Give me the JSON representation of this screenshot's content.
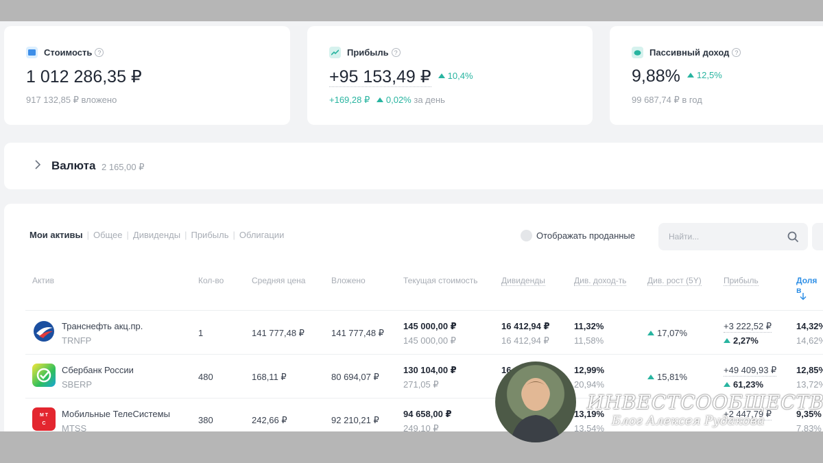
{
  "summary": {
    "value": {
      "label": "Стоимость",
      "amount": "1 012 286,35 ₽",
      "sub": "917 132,85 ₽ вложено"
    },
    "profit": {
      "label": "Прибыль",
      "amount": "+95 153,49 ₽",
      "change": "10,4%",
      "day_amount": "+169,28 ₽",
      "day_change": "0,02%",
      "day_label": "за день"
    },
    "passive": {
      "label": "Пассивный доход",
      "amount": "9,88%",
      "change": "12,5%",
      "sub": "99 687,74 ₽ в год"
    }
  },
  "currency": {
    "label": "Валюта",
    "amount": "2 165,00 ₽"
  },
  "tabs": [
    "Мои активы",
    "Общее",
    "Дивиденды",
    "Прибыль",
    "Облигации"
  ],
  "show_sold_label": "Отображать проданные",
  "search_placeholder": "Найти...",
  "columns": [
    "Актив",
    "Кол-во",
    "Средняя цена",
    "Вложено",
    "Текущая стоимость",
    "Дивиденды",
    "Див. доход-ть",
    "Див. рост (5Y)",
    "Прибыль",
    "Доля в"
  ],
  "rows": [
    {
      "name": "Транснефть акц.пр.",
      "ticker": "TRNFP",
      "qty": "1",
      "avg": "141 777,48 ₽",
      "invested": "141 777,48 ₽",
      "cur": "145 000,00 ₽",
      "cur2": "145 000,00 ₽",
      "div": "16 412,94 ₽",
      "div2": "16 412,94 ₽",
      "yield": "11,32%",
      "yield2": "11,58%",
      "growth": "17,07%",
      "profit": "+3 222,52 ₽",
      "profit_pct": "2,27%",
      "share": "14,32%",
      "share2": "14,62%"
    },
    {
      "name": "Сбербанк России",
      "ticker": "SBERP",
      "qty": "480",
      "avg": "168,11 ₽",
      "invested": "80 694,07 ₽",
      "cur": "130 104,00 ₽",
      "cur2": "271,05 ₽",
      "div": "16 1",
      "div2": "",
      "yield": "12,99%",
      "yield2": "20,94%",
      "growth": "15,81%",
      "profit": "+49 409,93 ₽",
      "profit_pct": "61,23%",
      "share": "12,85%",
      "share2": "13,72%"
    },
    {
      "name": "Мобильные ТелеСистемы",
      "ticker": "MTSS",
      "qty": "380",
      "avg": "242,66 ₽",
      "invested": "92 210,21 ₽",
      "cur": "94 658,00 ₽",
      "cur2": "249,10 ₽",
      "div": "",
      "div2": "",
      "yield": "13,19%",
      "yield2": "13,54%",
      "growth": "",
      "profit": "+2 447,79 ₽",
      "profit_pct": "",
      "share": "9,35%",
      "share2": "7,83%"
    }
  ],
  "watermark": {
    "title": "ИНВЕСТСООБЩЕСТВО",
    "subtitle": "Блог Алексея Рудакова"
  },
  "colors": {
    "accent": "#28b4a0",
    "link": "#2e8fe6"
  }
}
